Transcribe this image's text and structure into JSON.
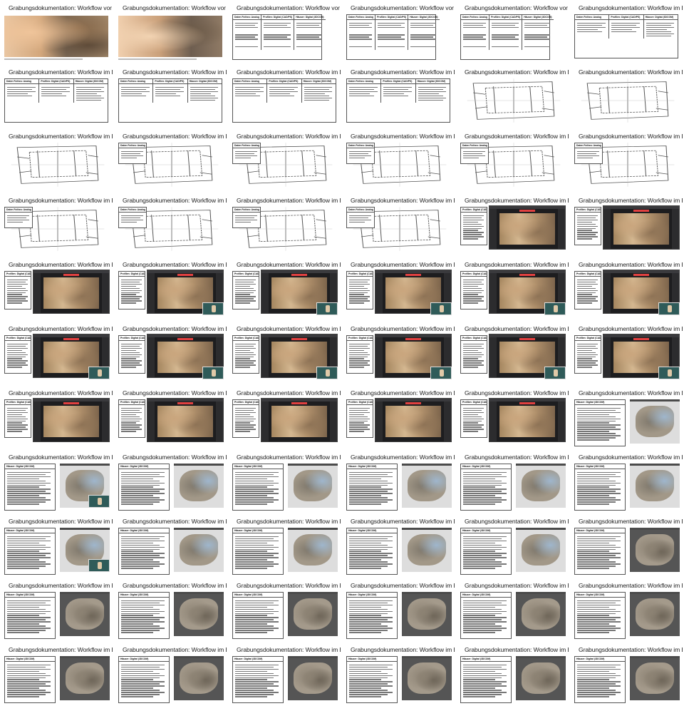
{
  "titles": {
    "vor_ort": "Grabungsdokumentation: Workflow vor Ort",
    "im_buero": "Grabungsdokumentation: Workflow im Büro"
  },
  "box_headers": {
    "h0": "Daten Fotheo: Analog",
    "h1": "Profilen: Digital (CAD/PS)",
    "h2": "Häuser: Digital (3DCOM)"
  },
  "slides": [
    {
      "t": "vor_ort",
      "l": "photo-a"
    },
    {
      "t": "vor_ort",
      "l": "photo-b"
    },
    {
      "t": "vor_ort",
      "l": "box3"
    },
    {
      "t": "vor_ort",
      "l": "box3"
    },
    {
      "t": "vor_ort",
      "l": "box3"
    },
    {
      "t": "im_buero",
      "l": "box3x"
    },
    {
      "t": "im_buero",
      "l": "box3x"
    },
    {
      "t": "im_buero",
      "l": "box3x"
    },
    {
      "t": "im_buero",
      "l": "box3x"
    },
    {
      "t": "im_buero",
      "l": "box3x"
    },
    {
      "t": "im_buero",
      "l": "plan"
    },
    {
      "t": "im_buero",
      "l": "plan"
    },
    {
      "t": "im_buero",
      "l": "plan"
    },
    {
      "t": "im_buero",
      "l": "box1plan"
    },
    {
      "t": "im_buero",
      "l": "box1plan"
    },
    {
      "t": "im_buero",
      "l": "box1plan"
    },
    {
      "t": "im_buero",
      "l": "box1plan"
    },
    {
      "t": "im_buero",
      "l": "box1plan"
    },
    {
      "t": "im_buero",
      "l": "box1plan"
    },
    {
      "t": "im_buero",
      "l": "box1plan"
    },
    {
      "t": "im_buero",
      "l": "box1plan"
    },
    {
      "t": "im_buero",
      "l": "box1plan"
    },
    {
      "t": "im_buero",
      "l": "boxcad"
    },
    {
      "t": "im_buero",
      "l": "boxcad"
    },
    {
      "t": "im_buero",
      "l": "boxcad"
    },
    {
      "t": "im_buero",
      "l": "boxcadi"
    },
    {
      "t": "im_buero",
      "l": "boxcadi"
    },
    {
      "t": "im_buero",
      "l": "boxcadi"
    },
    {
      "t": "im_buero",
      "l": "boxcadi"
    },
    {
      "t": "im_buero",
      "l": "boxcadi"
    },
    {
      "t": "im_buero",
      "l": "boxcadi"
    },
    {
      "t": "im_buero",
      "l": "boxcadi"
    },
    {
      "t": "im_buero",
      "l": "boxcadi"
    },
    {
      "t": "im_buero",
      "l": "boxcadi"
    },
    {
      "t": "im_buero",
      "l": "boxcadi"
    },
    {
      "t": "im_buero",
      "l": "boxcadi"
    },
    {
      "t": "im_buero",
      "l": "boxcad"
    },
    {
      "t": "im_buero",
      "l": "boxcad"
    },
    {
      "t": "im_buero",
      "l": "boxcad"
    },
    {
      "t": "im_buero",
      "l": "boxcad"
    },
    {
      "t": "im_buero",
      "l": "boxcad"
    },
    {
      "t": "im_buero",
      "l": "boxmodel"
    },
    {
      "t": "im_buero",
      "l": "boxmodelb"
    },
    {
      "t": "im_buero",
      "l": "boxmodel"
    },
    {
      "t": "im_buero",
      "l": "boxmodel"
    },
    {
      "t": "im_buero",
      "l": "boxmodel"
    },
    {
      "t": "im_buero",
      "l": "boxmodel"
    },
    {
      "t": "im_buero",
      "l": "boxmodel"
    },
    {
      "t": "im_buero",
      "l": "boxmodelb"
    },
    {
      "t": "im_buero",
      "l": "boxmodel"
    },
    {
      "t": "im_buero",
      "l": "boxmodel"
    },
    {
      "t": "im_buero",
      "l": "boxmodel"
    },
    {
      "t": "im_buero",
      "l": "boxmodel"
    },
    {
      "t": "im_buero",
      "l": "boxmodeld"
    },
    {
      "t": "im_buero",
      "l": "boxmodeld"
    },
    {
      "t": "im_buero",
      "l": "boxmodeld"
    },
    {
      "t": "im_buero",
      "l": "boxmodeld"
    },
    {
      "t": "im_buero",
      "l": "boxmodeld"
    },
    {
      "t": "im_buero",
      "l": "boxmodeld"
    },
    {
      "t": "im_buero",
      "l": "boxmodeld"
    },
    {
      "t": "im_buero",
      "l": "boxmodeld"
    },
    {
      "t": "im_buero",
      "l": "boxmodeld"
    },
    {
      "t": "im_buero",
      "l": "boxmodeld"
    },
    {
      "t": "im_buero",
      "l": "boxmodeld"
    },
    {
      "t": "im_buero",
      "l": "boxmodeld"
    },
    {
      "t": "im_buero",
      "l": "boxmodeld"
    }
  ]
}
